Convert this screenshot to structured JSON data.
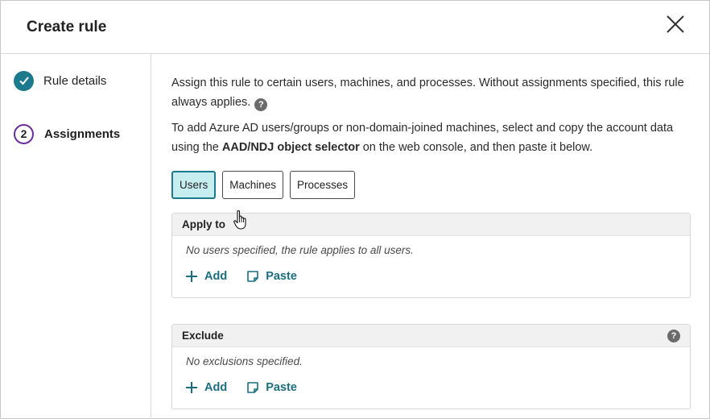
{
  "dialog": {
    "title": "Create rule"
  },
  "steps": [
    {
      "label": "Rule details",
      "state": "completed"
    },
    {
      "number": "2",
      "label": "Assignments",
      "state": "current"
    }
  ],
  "intro": {
    "text": "Assign this rule to certain users, machines, and processes. Without assignments specified, this rule always applies.",
    "help_glyph": "?"
  },
  "azure_note": {
    "prefix": "To add Azure AD users/groups or non-domain-joined machines, select and copy the account data using the ",
    "bold": "AAD/NDJ object selector",
    "suffix": " on the web console, and then paste it below."
  },
  "tabs": [
    {
      "label": "Users",
      "active": true
    },
    {
      "label": "Machines",
      "active": false
    },
    {
      "label": "Processes",
      "active": false
    }
  ],
  "apply_to": {
    "heading": "Apply to",
    "message": "No users specified, the rule applies to all users.",
    "add_label": "Add",
    "paste_label": "Paste"
  },
  "exclude": {
    "heading": "Exclude",
    "help_glyph": "?",
    "message": "No exclusions specified.",
    "add_label": "Add",
    "paste_label": "Paste"
  },
  "colors": {
    "accent_teal": "#1b7a8c",
    "step_purple": "#6a2f9c",
    "active_tab_bg": "#c6eef1",
    "link": "#1b6e80"
  },
  "icons": {
    "close": "close-icon",
    "check": "check-icon",
    "help": "help-icon",
    "add": "plus-icon",
    "paste": "paste-icon",
    "cursor": "hand-cursor-icon"
  }
}
